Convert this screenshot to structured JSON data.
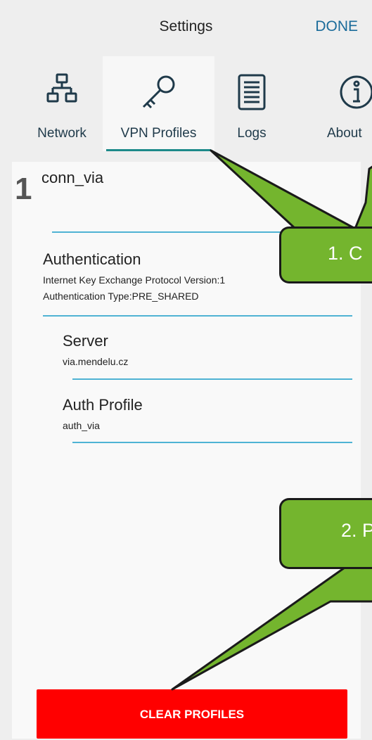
{
  "header": {
    "title": "Settings",
    "done_label": "DONE"
  },
  "tabs": [
    {
      "label": "Network",
      "icon": "network-icon"
    },
    {
      "label": "VPN Profiles",
      "icon": "key-icon",
      "active": true
    },
    {
      "label": "Logs",
      "icon": "document-icon"
    },
    {
      "label": "About",
      "icon": "info-icon"
    }
  ],
  "profile": {
    "number": "1",
    "name": "conn_via",
    "authentication": {
      "title": "Authentication",
      "line1": "Internet Key Exchange Protocol Version:1",
      "line2": "Authentication Type:PRE_SHARED"
    },
    "server": {
      "title": "Server",
      "value": "via.mendelu.cz"
    },
    "auth_profile": {
      "title": "Auth Profile",
      "value": "auth_via"
    }
  },
  "clear_button": "CLEAR PROFILES",
  "callouts": {
    "first": "1. C",
    "second": "2. P"
  },
  "colors": {
    "accent_line": "#4fb3d4",
    "tab_underline": "#1d8a8a",
    "clear_button": "#ff0000",
    "callout": "#74b52e",
    "done": "#1a6b9a"
  }
}
